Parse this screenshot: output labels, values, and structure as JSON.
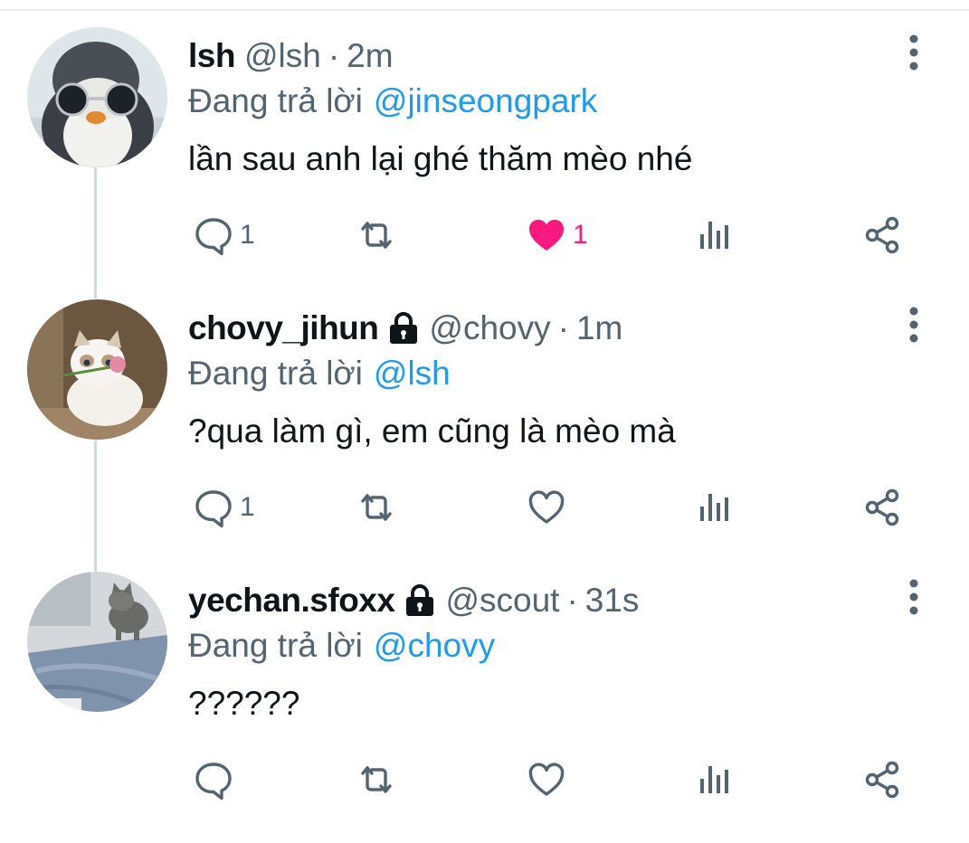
{
  "tweets": [
    {
      "display_name": "lsh",
      "locked": false,
      "handle": "@lsh",
      "time": "2m",
      "reply_prefix": "Đang trả lời",
      "reply_to": "@jinseongpark",
      "text": "lần sau anh lại ghé thăm mèo nhé",
      "reply_count": "1",
      "retweet_count": "",
      "like_count": "1",
      "liked": true,
      "avatar_icon": "penguin-with-sunglasses-avatar"
    },
    {
      "display_name": "chovy_jihun",
      "locked": true,
      "handle": "@chovy",
      "time": "1m",
      "reply_prefix": "Đang trả lời",
      "reply_to": "@lsh",
      "text": "?qua làm gì, em cũng là mèo mà",
      "reply_count": "1",
      "retweet_count": "",
      "like_count": "",
      "liked": false,
      "avatar_icon": "white-cat-with-flower-avatar"
    },
    {
      "display_name": "yechan.sfoxx",
      "locked": true,
      "handle": "@scout",
      "time": "31s",
      "reply_prefix": "Đang trả lời",
      "reply_to": "@chovy",
      "text": "??????",
      "reply_count": "",
      "retweet_count": "",
      "like_count": "",
      "liked": false,
      "avatar_icon": "grey-cat-on-lap-avatar"
    }
  ],
  "separator": "·",
  "colors": {
    "mention": "#1d9bf0",
    "muted": "#536471",
    "text": "#0f1419",
    "like_active": "#f91880",
    "thread_line": "#cfd9de"
  }
}
